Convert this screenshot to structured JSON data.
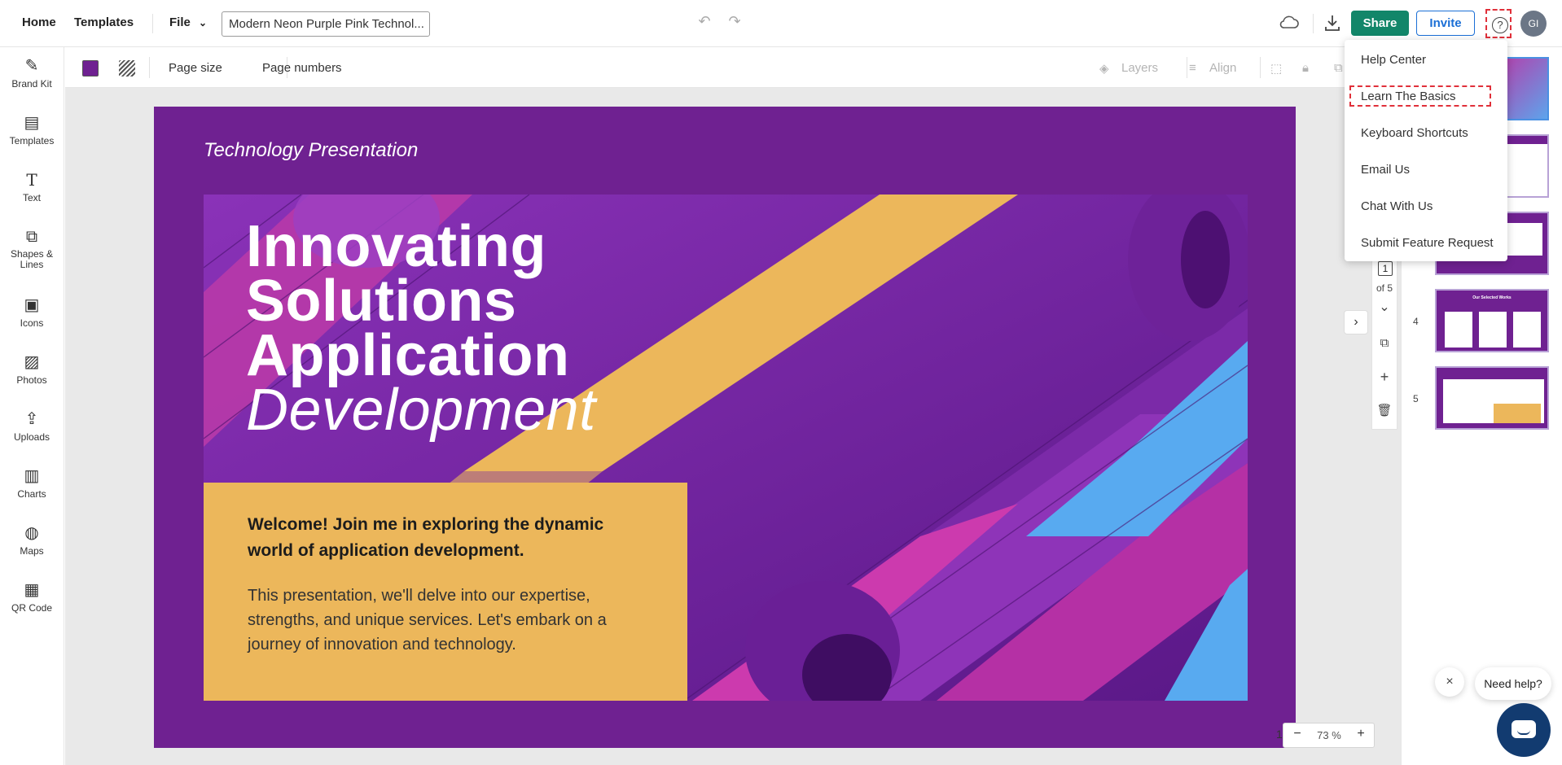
{
  "topbar": {
    "home": "Home",
    "templates": "Templates",
    "file": "File",
    "document_title": "Modern Neon Purple Pink Technol...",
    "share": "Share",
    "invite": "Invite",
    "help": "?",
    "avatar_initials": "GI",
    "icons": [
      "undo-icon",
      "redo-icon",
      "cloud-save-icon",
      "download-icon",
      "help-icon"
    ]
  },
  "sidebar": {
    "items": [
      {
        "label": "Brand Kit",
        "icon": "magic-wand-icon"
      },
      {
        "label": "Templates",
        "icon": "templates-icon"
      },
      {
        "label": "Text",
        "icon": "text-icon"
      },
      {
        "label": "Shapes &\nLines",
        "icon": "shapes-icon"
      },
      {
        "label": "Icons",
        "icon": "briefcase-icon"
      },
      {
        "label": "Photos",
        "icon": "photo-icon"
      },
      {
        "label": "Uploads",
        "icon": "upload-icon"
      },
      {
        "label": "Charts",
        "icon": "bar-chart-icon"
      },
      {
        "label": "Maps",
        "icon": "globe-icon"
      },
      {
        "label": "QR Code",
        "icon": "qr-code-icon"
      }
    ]
  },
  "toolbar": {
    "background_color": "#6f2191",
    "page_size": "Page size",
    "page_numbers": "Page numbers",
    "layers": "Layers",
    "align": "Align"
  },
  "slide": {
    "subtitle": "Technology Presentation",
    "title_lines": [
      "Innovating",
      "Solutions",
      "Application"
    ],
    "title_italic": "Development",
    "welcome_heading": "Welcome! Join me in exploring the dynamic world of application development.",
    "welcome_body": "This presentation, we'll delve into our expertise, strengths, and unique services. Let's embark on a journey of innovation and technology.",
    "colors": {
      "background": "#6f2191",
      "box": "#ecb75b",
      "stripe_yellow": "#ecb75b",
      "stripe_pink": "#cc3aae",
      "stripe_blue": "#58aaf0"
    }
  },
  "zoom": {
    "current_page": "1",
    "minus": "−",
    "value": "73 %",
    "plus": "+"
  },
  "page_nav": {
    "current": "1",
    "of_total": "of 5"
  },
  "thumbnails": {
    "pages": [
      "1",
      "2",
      "3",
      "4",
      "5"
    ],
    "slide4_title": "Our Selected Works"
  },
  "help_menu": {
    "items": [
      "Help Center",
      "Learn The Basics",
      "Keyboard Shortcuts",
      "Email Us",
      "Chat With Us",
      "Submit Feature Request"
    ]
  },
  "support": {
    "need_help": "Need help?",
    "close": "×"
  }
}
